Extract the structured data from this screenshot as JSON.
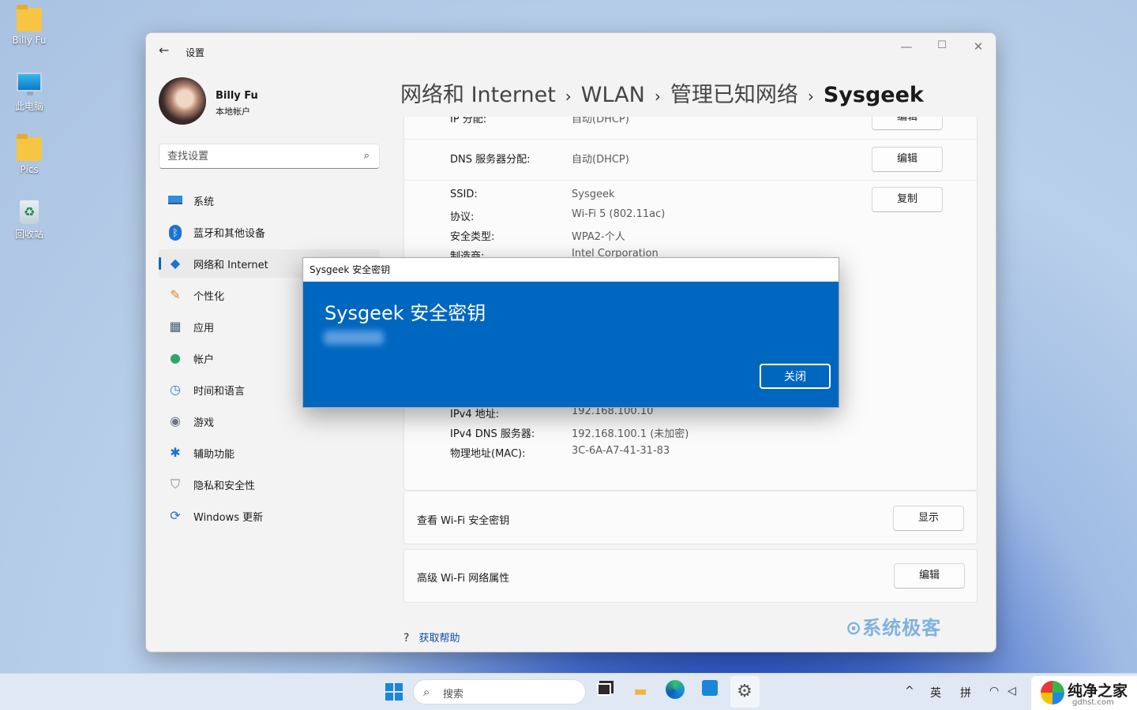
{
  "desktop": {
    "icons": [
      {
        "label": "Billy Fu",
        "icon": "folder-icon"
      },
      {
        "label": "此电脑",
        "icon": "computer-icon"
      },
      {
        "label": "Pics",
        "icon": "folder-icon"
      },
      {
        "label": "回收站",
        "icon": "recycle-bin-icon"
      }
    ]
  },
  "window": {
    "app_title": "设置",
    "controls": {
      "minimize": "—",
      "maximize": "☐",
      "close": "✕"
    },
    "profile": {
      "name": "Billy Fu",
      "account_type": "本地帐户"
    },
    "search": {
      "placeholder": "查找设置"
    },
    "nav": [
      {
        "label": "系统",
        "icon": "system-icon",
        "active": false
      },
      {
        "label": "蓝牙和其他设备",
        "icon": "bluetooth-icon",
        "active": false
      },
      {
        "label": "网络和 Internet",
        "icon": "network-icon",
        "active": true
      },
      {
        "label": "个性化",
        "icon": "brush-icon",
        "active": false
      },
      {
        "label": "应用",
        "icon": "apps-icon",
        "active": false
      },
      {
        "label": "帐户",
        "icon": "account-icon",
        "active": false
      },
      {
        "label": "时间和语言",
        "icon": "clock-icon",
        "active": false
      },
      {
        "label": "游戏",
        "icon": "gamepad-icon",
        "active": false
      },
      {
        "label": "辅助功能",
        "icon": "accessibility-icon",
        "active": false
      },
      {
        "label": "隐私和安全性",
        "icon": "shield-icon",
        "active": false
      },
      {
        "label": "Windows 更新",
        "icon": "update-icon",
        "active": false
      }
    ],
    "breadcrumb": [
      "网络和 Internet",
      "WLAN",
      "管理已知网络",
      "Sysgeek"
    ],
    "breadcrumb_sep": "›",
    "details": {
      "ip_row": {
        "label": "IP 分配:",
        "value": "自动(DHCP)",
        "button": "编辑"
      },
      "dns_row": {
        "label": "DNS 服务器分配:",
        "value": "自动(DHCP)",
        "button": "编辑"
      },
      "copy_button": "复制",
      "props": [
        {
          "label": "SSID:",
          "value": "Sysgeek"
        },
        {
          "label": "协议:",
          "value": "Wi-Fi 5 (802.11ac)"
        },
        {
          "label": "安全类型:",
          "value": "WPA2-个人"
        },
        {
          "label": "制造商:",
          "value": "Intel Corporation"
        }
      ],
      "props_bottom": [
        {
          "label": "IPv4 地址:",
          "value": "192.168.100.10"
        },
        {
          "label": "IPv4 DNS 服务器:",
          "value": "192.168.100.1 (未加密)"
        },
        {
          "label": "物理地址(MAC):",
          "value": "3C-6A-A7-41-31-83"
        }
      ]
    },
    "view_key": {
      "label": "查看 Wi-Fi 安全密钥",
      "button": "显示"
    },
    "advanced": {
      "label": "高级 Wi-Fi 网络属性",
      "button": "编辑"
    },
    "help": "获取帮助",
    "watermark": "系统极客"
  },
  "dialog": {
    "title": "Sysgeek 安全密钥",
    "heading": "Sysgeek 安全密钥",
    "close_button": "关闭",
    "bg_color": "#0067c0"
  },
  "taskbar": {
    "search_placeholder": "搜索",
    "tray": {
      "lang1": "英",
      "lang2": "拼",
      "chevron": "^"
    },
    "brand": {
      "name": "纯净之家",
      "url": "gdhst.com"
    }
  }
}
